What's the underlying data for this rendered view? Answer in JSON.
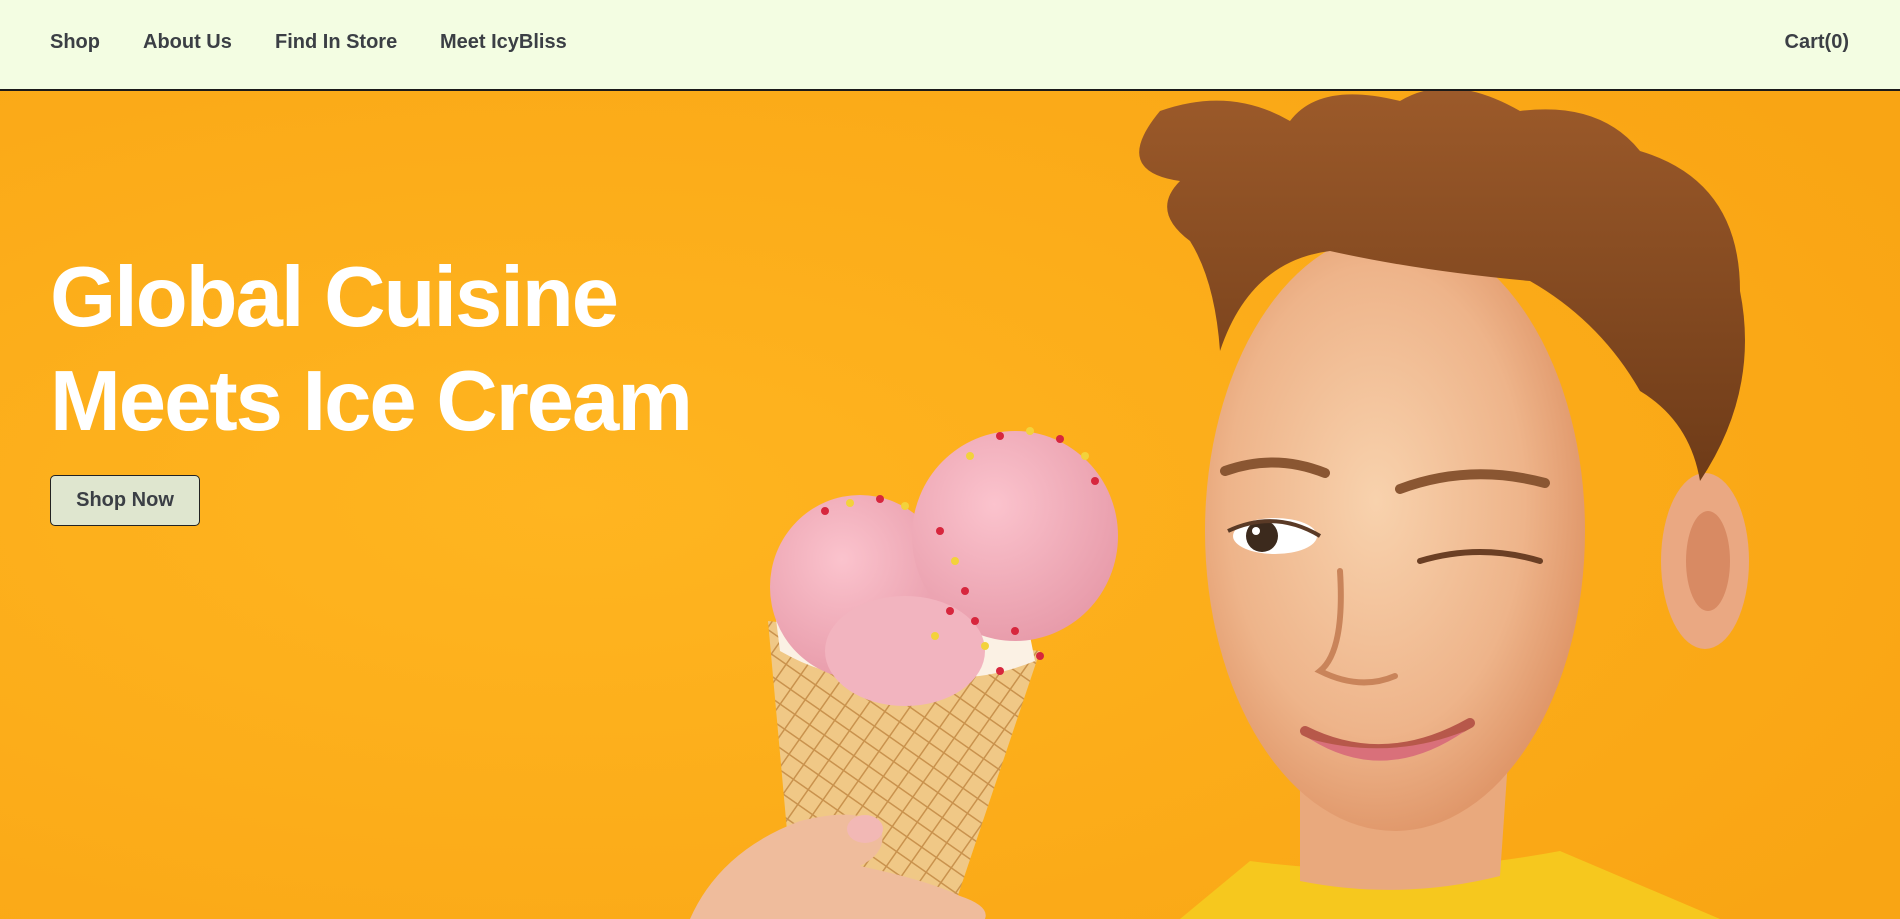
{
  "nav": {
    "items": [
      {
        "label": "Shop"
      },
      {
        "label": "About Us"
      },
      {
        "label": "Find In Store"
      },
      {
        "label": "Meet IcyBliss"
      }
    ],
    "cart_label": "Cart(0)"
  },
  "hero": {
    "title_line1": "Global Cuisine",
    "title_line2": "Meets Ice Cream",
    "cta_label": "Shop Now",
    "background_color": "#ffb01c",
    "image_subject": "child-with-ice-cream-cone"
  },
  "colors": {
    "header_bg": "#f3fde2",
    "nav_text": "#3b3f45",
    "button_bg": "#dfe6cf",
    "title_text": "#ffffff"
  }
}
